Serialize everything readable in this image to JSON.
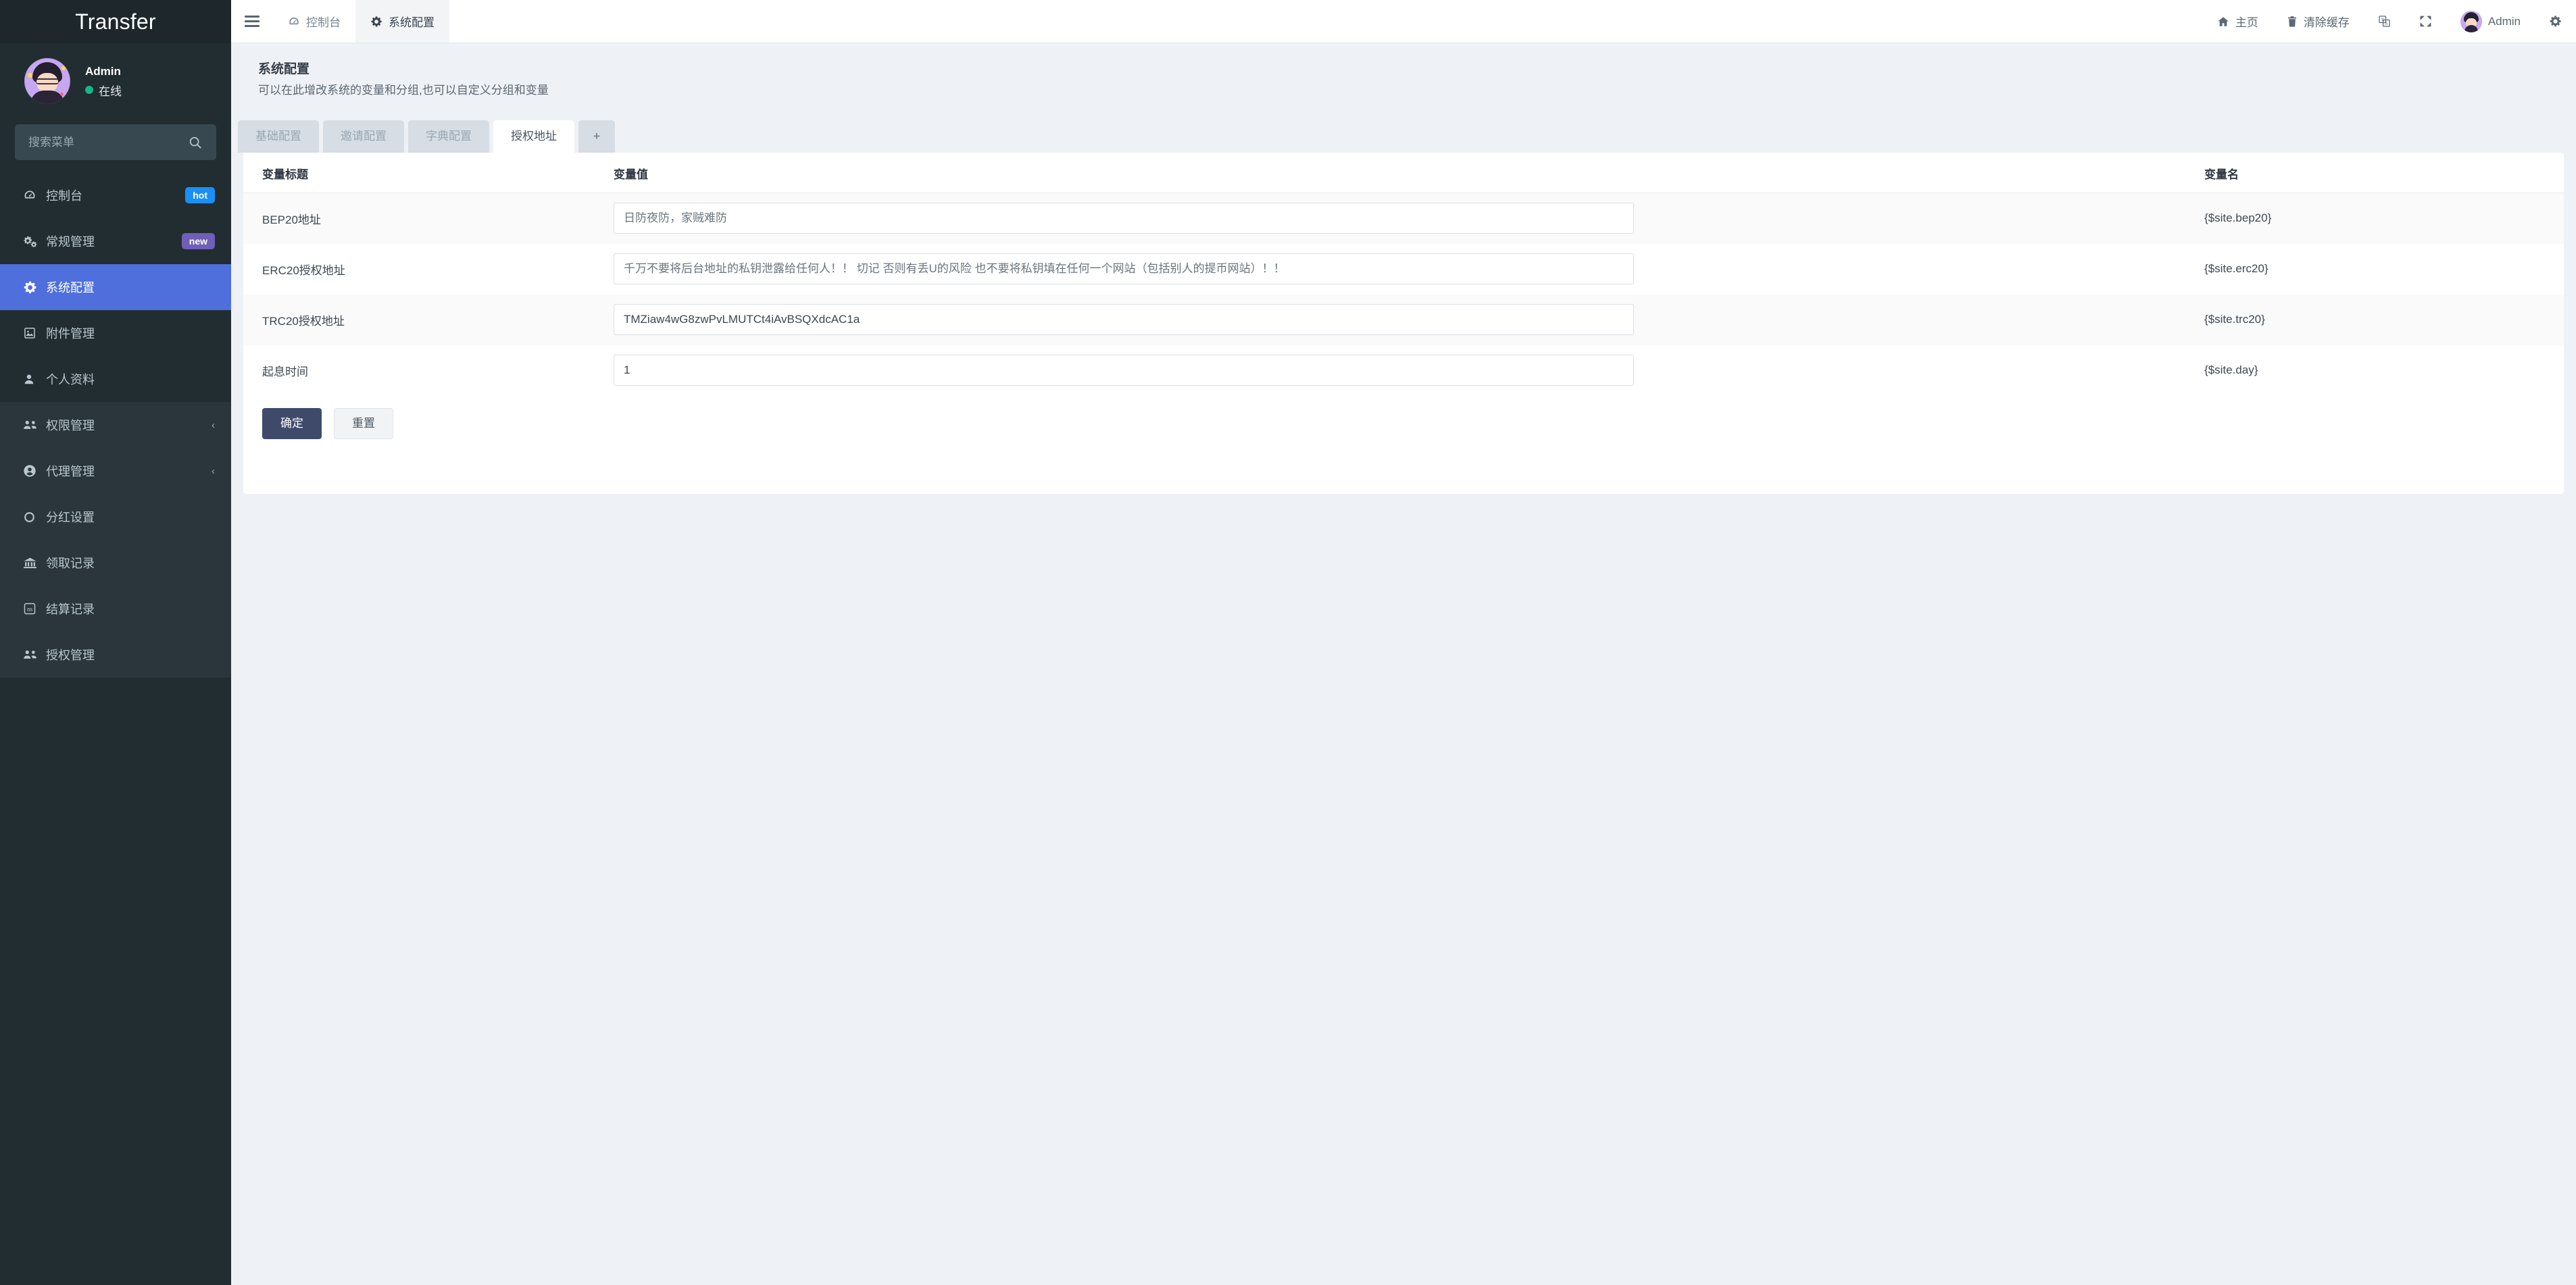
{
  "brand": {
    "title": "Transfer"
  },
  "user": {
    "name": "Admin",
    "status": "在线",
    "status_color": "#12b886"
  },
  "search": {
    "placeholder": "搜索菜单",
    "value": ""
  },
  "sidebar": {
    "items": [
      {
        "label": "控制台",
        "icon": "dashboard-icon",
        "badge": "hot",
        "badge_color": "#1a8ff5",
        "active": false
      },
      {
        "label": "常规管理",
        "icon": "cogs-icon",
        "badge": "new",
        "badge_color": "#6f5fb8",
        "active": false
      },
      {
        "label": "系统配置",
        "icon": "gear-icon",
        "badge": "",
        "active": true
      },
      {
        "label": "附件管理",
        "icon": "image-file-icon",
        "badge": "",
        "active": false
      },
      {
        "label": "个人资料",
        "icon": "user-icon",
        "badge": "",
        "active": false
      },
      {
        "label": "权限管理",
        "icon": "users-icon",
        "chevron": "‹",
        "active": false
      },
      {
        "label": "代理管理",
        "icon": "user-circle-icon",
        "chevron": "‹",
        "active": false
      },
      {
        "label": "分红设置",
        "icon": "circle-icon",
        "active": false
      },
      {
        "label": "领取记录",
        "icon": "bank-icon",
        "active": false
      },
      {
        "label": "结算记录",
        "icon": "lastfm-icon",
        "active": false
      },
      {
        "label": "授权管理",
        "icon": "users-icon",
        "active": false
      }
    ],
    "active_color": "#4f6fdd"
  },
  "topbar": {
    "menu_toggle": "menu-icon",
    "nav": [
      {
        "label": "控制台",
        "icon": "dashboard-icon",
        "active": false
      },
      {
        "label": "系统配置",
        "icon": "gear-icon",
        "active": true
      }
    ],
    "right": [
      {
        "label": "主页",
        "icon": "home-icon"
      },
      {
        "label": "清除缓存",
        "icon": "trash-icon"
      },
      {
        "label": "",
        "icon": "translate-icon"
      },
      {
        "label": "",
        "icon": "fullscreen-icon"
      },
      {
        "label": "Admin",
        "icon": "avatar"
      },
      {
        "label": "",
        "icon": "gear-icon"
      }
    ]
  },
  "page": {
    "title": "系统配置",
    "subtitle": "可以在此增改系统的变量和分组,也可以自定义分组和变量"
  },
  "tabs": [
    {
      "label": "基础配置",
      "active": false
    },
    {
      "label": "邀请配置",
      "active": false
    },
    {
      "label": "字典配置",
      "active": false
    },
    {
      "label": "授权地址",
      "active": true
    },
    {
      "label": "+",
      "active": false,
      "is_add": true
    }
  ],
  "table": {
    "headers": {
      "title": "变量标题",
      "value": "变量值",
      "name": "变量名"
    },
    "rows": [
      {
        "title": "BEP20地址",
        "value": "",
        "placeholder": "日防夜防，家贼难防",
        "name": "{$site.bep20}"
      },
      {
        "title": "ERC20授权地址",
        "value": "",
        "placeholder": "千万不要将后台地址的私钥泄露给任何人！！ 切记 否则有丢U的风险 也不要将私钥填在任何一个网站（包括别人的提币网站）！！",
        "name": "{$site.erc20}"
      },
      {
        "title": "TRC20授权地址",
        "value": "TMZiaw4wG8zwPvLMUTCt4iAvBSQXdcAC1a",
        "placeholder": "",
        "name": "{$site.trc20}"
      },
      {
        "title": "起息时间",
        "value": "1",
        "placeholder": "",
        "name": "{$site.day}"
      }
    ]
  },
  "buttons": {
    "submit": "确定",
    "reset": "重置",
    "submit_color": "#3f4a6b"
  }
}
